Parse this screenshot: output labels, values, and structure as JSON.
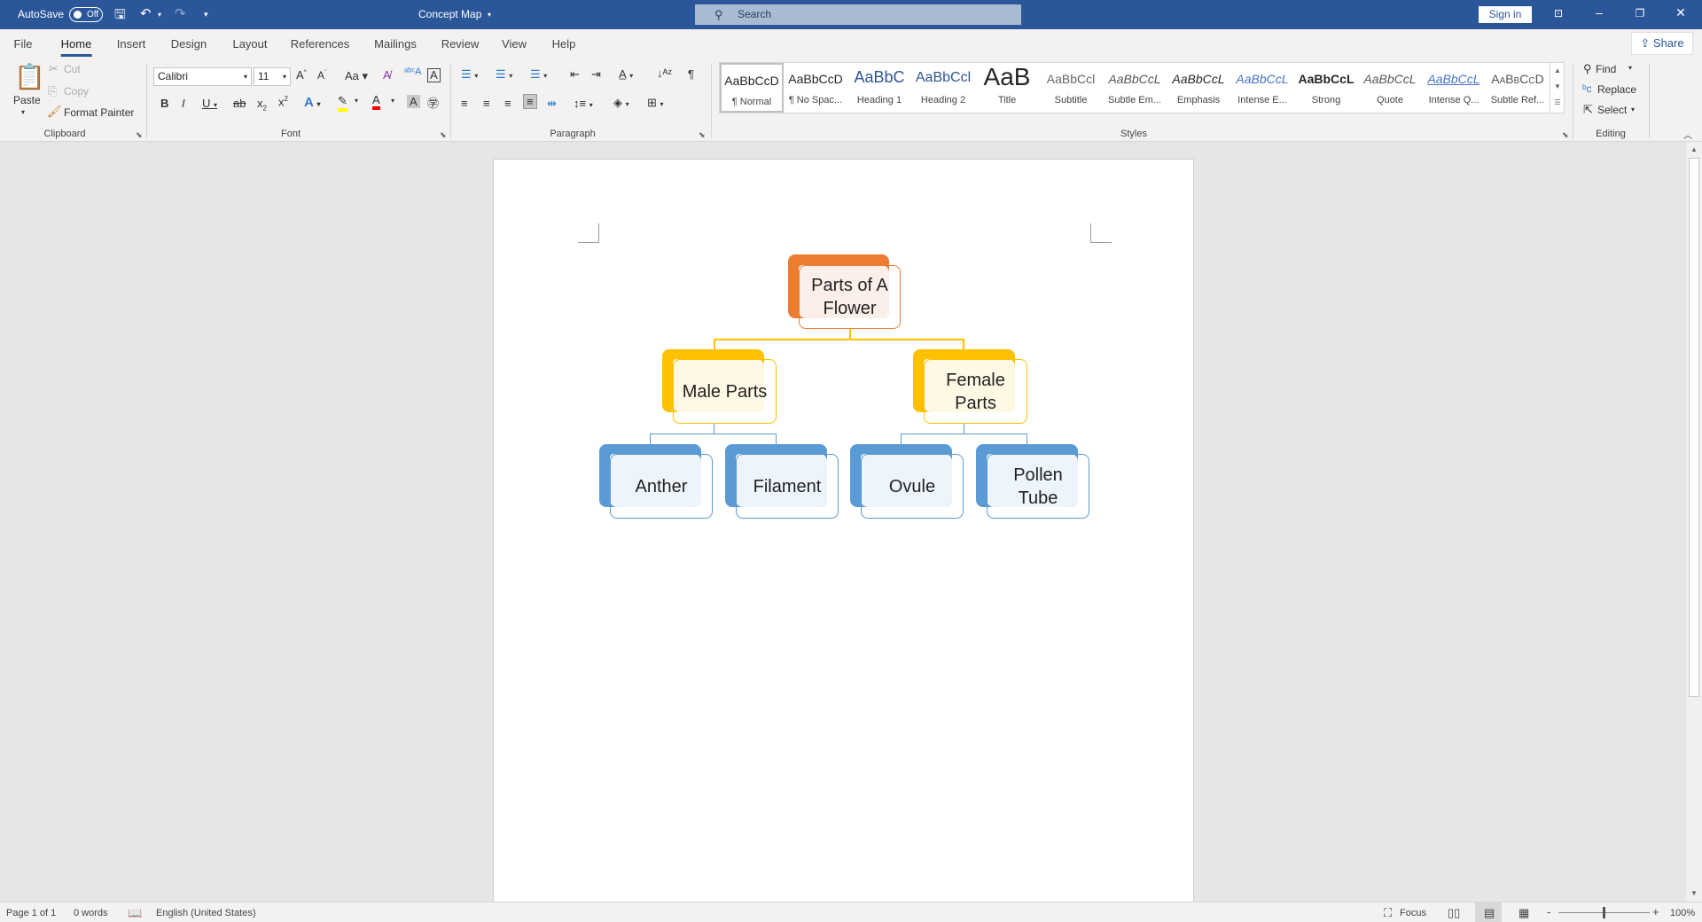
{
  "titlebar": {
    "autosave": "AutoSave",
    "autosave_state": "Off",
    "doc_title": "Concept Map",
    "search_placeholder": "Search",
    "sign_in": "Sign in"
  },
  "tabs": [
    {
      "label": "File"
    },
    {
      "label": "Home",
      "active": true
    },
    {
      "label": "Insert"
    },
    {
      "label": "Design"
    },
    {
      "label": "Layout"
    },
    {
      "label": "References"
    },
    {
      "label": "Mailings"
    },
    {
      "label": "Review"
    },
    {
      "label": "View"
    },
    {
      "label": "Help"
    }
  ],
  "share": "Share",
  "clipboard": {
    "paste": "Paste",
    "cut": "Cut",
    "copy": "Copy",
    "format_painter": "Format Painter",
    "label": "Clipboard"
  },
  "font": {
    "name": "Calibri",
    "size": "11",
    "label": "Font",
    "highlight_color": "#ffff00",
    "font_color": "#ff0000"
  },
  "paragraph": {
    "label": "Paragraph"
  },
  "styles": {
    "label": "Styles",
    "items": [
      {
        "preview": "AaBbCcD",
        "name": "¶ Normal"
      },
      {
        "preview": "AaBbCcD",
        "name": "¶ No Spac..."
      },
      {
        "preview": "AaBbC",
        "name": "Heading 1"
      },
      {
        "preview": "AaBbCcl",
        "name": "Heading 2"
      },
      {
        "preview": "AaB",
        "name": "Title"
      },
      {
        "preview": "AaBbCcl",
        "name": "Subtitle"
      },
      {
        "preview": "AaBbCcL",
        "name": "Subtle Em..."
      },
      {
        "preview": "AaBbCcL",
        "name": "Emphasis"
      },
      {
        "preview": "AaBbCcL",
        "name": "Intense E..."
      },
      {
        "preview": "AaBbCcL",
        "name": "Strong"
      },
      {
        "preview": "AaBbCcL",
        "name": "Quote"
      },
      {
        "preview": "AaBbCcL",
        "name": "Intense Q..."
      },
      {
        "preview": "AaBbCcD",
        "name": "Subtle Ref..."
      }
    ]
  },
  "editing": {
    "find": "Find",
    "replace": "Replace",
    "select": "Select",
    "label": "Editing"
  },
  "diagram": {
    "root": {
      "text": "Parts of A Flower",
      "color": "#ed7d31",
      "tint": "#fcefe9"
    },
    "level2": [
      {
        "text": "Male Parts"
      },
      {
        "text": "Female Parts"
      }
    ],
    "level2_color": "#ffc000",
    "level2_tint": "#fff8e5",
    "level3": [
      {
        "text": "Anther"
      },
      {
        "text": "Filament"
      },
      {
        "text": "Ovule"
      },
      {
        "text": "Pollen Tube"
      }
    ],
    "level3_color": "#5b9bd5",
    "level3_tint": "#eef4fb"
  },
  "status": {
    "page": "Page 1 of 1",
    "words": "0 words",
    "language": "English (United States)",
    "focus": "Focus",
    "zoom": "100%"
  }
}
